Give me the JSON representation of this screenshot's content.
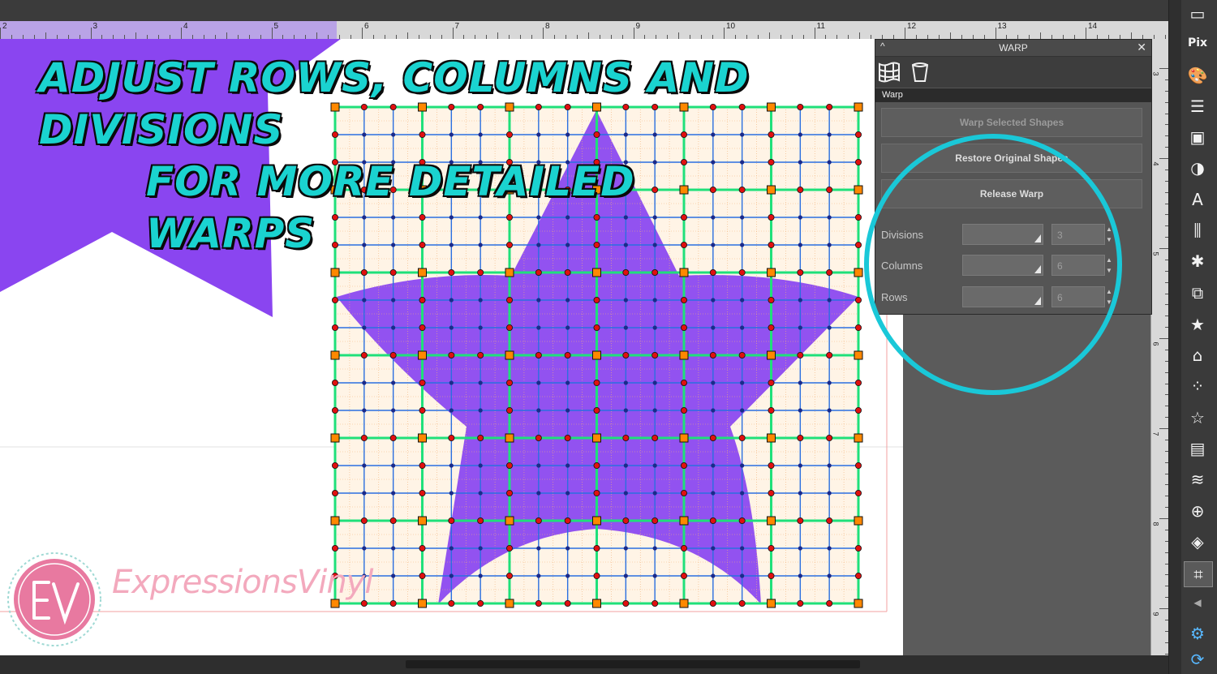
{
  "headline": {
    "line1": "ADJUST ROWS, COLUMNS AND DIVISIONS",
    "line2": "FOR MORE DETAILED WARPS"
  },
  "ruler": {
    "numbers": [
      "2",
      "3",
      "4",
      "5",
      "6",
      "7",
      "8",
      "9",
      "10",
      "11",
      "12",
      "13",
      "14"
    ]
  },
  "vruler": {
    "numbers": [
      "3",
      "4",
      "5",
      "6",
      "7",
      "8",
      "9"
    ]
  },
  "panel": {
    "title": "WARP",
    "caret": "^",
    "close": "✕",
    "section": "Warp",
    "buttons": {
      "warp_selected": "Warp Selected Shapes",
      "restore_original": "Restore Original Shapes",
      "release_warp": "Release Warp"
    },
    "fields": {
      "divisions": {
        "label": "Divisions",
        "value": "3"
      },
      "columns": {
        "label": "Columns",
        "value": "6"
      },
      "rows": {
        "label": "Rows",
        "value": "6"
      }
    }
  },
  "toolbar": {
    "icons": [
      "page-icon",
      "pixscan-icon",
      "palette-icon",
      "lines-icon",
      "fill-icon",
      "contrast-icon",
      "text-icon",
      "align-icon",
      "transform-icon",
      "replicate-icon",
      "star-icon",
      "design-store-icon",
      "offset-icon",
      "star-outline-icon",
      "trace-icon",
      "sketch-icon",
      "library-icon",
      "cube-icon",
      "warp-icon"
    ]
  },
  "watermark": {
    "monogram": "EV",
    "brand": "ExpressionsVinyl"
  },
  "colors": {
    "star": "#8a45f0",
    "headline": "#1ad3d0",
    "circle": "#1ac8d8",
    "grid_major": "#1fe07a",
    "grid_minor": "#2a6fe0",
    "node_red": "#e01010",
    "node_orange": "#ff8800",
    "logo_pink": "#e879a0"
  }
}
